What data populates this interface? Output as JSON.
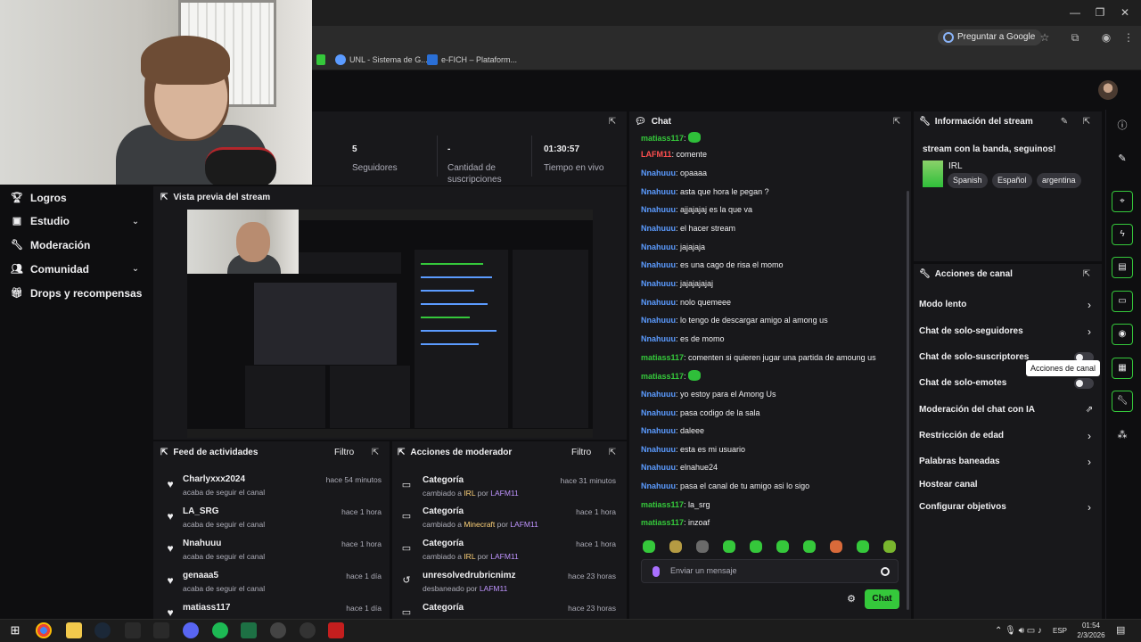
{
  "browser": {
    "ask_google": "Preguntar a Google",
    "bookmarks": [
      {
        "label": "UNL - Sistema de G..."
      },
      {
        "label": "e-FICH – Plataform..."
      }
    ]
  },
  "sidebar": {
    "items": [
      {
        "label": "Logros",
        "icon": "trophy-icon"
      },
      {
        "label": "Estudio",
        "icon": "camera-icon"
      },
      {
        "label": "Moderación",
        "icon": "wrench-icon"
      },
      {
        "label": "Comunidad",
        "icon": "people-icon"
      },
      {
        "label": "Drops y recompensas",
        "icon": "gift-icon"
      }
    ]
  },
  "stats": {
    "followers_value": "5",
    "followers_label": "Seguidores",
    "subs_value": "-",
    "subs_label": "Cantidad de suscripciones",
    "live_value": "01:30:57",
    "live_label": "Tiempo en vivo"
  },
  "preview": {
    "title": "Vista previa del stream"
  },
  "feed": {
    "title": "Feed de actividades",
    "filter": "Filtro",
    "items": [
      {
        "name": "Charlyxxx2024",
        "sub": "acaba de seguir el canal",
        "time": "hace 54 minutos"
      },
      {
        "name": "LA_SRG",
        "sub": "acaba de seguir el canal",
        "time": "hace 1 hora"
      },
      {
        "name": "Nnahuuu",
        "sub": "acaba de seguir el canal",
        "time": "hace 1 hora"
      },
      {
        "name": "genaaa5",
        "sub": "acaba de seguir el canal",
        "time": "hace 1 día"
      },
      {
        "name": "matiass117",
        "sub": "",
        "time": "hace 1 día"
      }
    ]
  },
  "mod": {
    "title": "Acciones de moderador",
    "filter": "Filtro",
    "items": [
      {
        "title": "Categoría",
        "pre": "cambiado a ",
        "target": "IRL",
        "mid": " por ",
        "by": "LAFM11",
        "time": "hace 31 minutos"
      },
      {
        "title": "Categoría",
        "pre": "cambiado a ",
        "target": "Minecraft",
        "mid": " por ",
        "by": "LAFM11",
        "time": "hace 1 hora"
      },
      {
        "title": "Categoría",
        "pre": "cambiado a ",
        "target": "IRL",
        "mid": " por ",
        "by": "LAFM11",
        "time": "hace 1 hora"
      },
      {
        "title": "unresolvedrubricnimz",
        "pre": "desbaneado por ",
        "target": "",
        "mid": "",
        "by": "LAFM11",
        "time": "hace 23 horas"
      },
      {
        "title": "Categoría",
        "pre": "",
        "target": "",
        "mid": "",
        "by": "",
        "time": "hace 23 horas"
      }
    ]
  },
  "chat": {
    "title": "Chat",
    "placeholder": "Enviar un mensaje",
    "send": "Chat",
    "messages": [
      {
        "user": "matiass117",
        "color": "#35c83b",
        "text": ": ",
        "emote": true
      },
      {
        "user": "LAFM11",
        "color": "#ff4f4f",
        "text": ": comente",
        "emote": false
      },
      {
        "user": "Nnahuuu",
        "color": "#5b9bff",
        "text": ": opaaaa",
        "emote": false
      },
      {
        "user": "Nnahuuu",
        "color": "#5b9bff",
        "text": ": asta que hora le pegan ?",
        "emote": false
      },
      {
        "user": "Nnahuuu",
        "color": "#5b9bff",
        "text": ": ajjajajaj es la que va",
        "emote": false
      },
      {
        "user": "Nnahuuu",
        "color": "#5b9bff",
        "text": ": el hacer stream",
        "emote": false
      },
      {
        "user": "Nnahuuu",
        "color": "#5b9bff",
        "text": ": jajajaja",
        "emote": false
      },
      {
        "user": "Nnahuuu",
        "color": "#5b9bff",
        "text": ": es una cago de risa el momo",
        "emote": false
      },
      {
        "user": "Nnahuuu",
        "color": "#5b9bff",
        "text": ": jajajajajaj",
        "emote": false
      },
      {
        "user": "Nnahuuu",
        "color": "#5b9bff",
        "text": ": nolo quemeee",
        "emote": false
      },
      {
        "user": "Nnahuuu",
        "color": "#5b9bff",
        "text": ": lo tengo de descargar amigo al among us",
        "emote": false
      },
      {
        "user": "Nnahuuu",
        "color": "#5b9bff",
        "text": ": es de momo",
        "emote": false
      },
      {
        "user": "matiass117",
        "color": "#35c83b",
        "text": ": comenten si quieren jugar una partida de amoung us",
        "emote": false
      },
      {
        "user": "matiass117",
        "color": "#35c83b",
        "text": ": ",
        "emote": true
      },
      {
        "user": "Nnahuuu",
        "color": "#5b9bff",
        "text": ": yo estoy para el Among Us",
        "emote": false
      },
      {
        "user": "Nnahuuu",
        "color": "#5b9bff",
        "text": ": pasa codigo de la sala",
        "emote": false
      },
      {
        "user": "Nnahuuu",
        "color": "#5b9bff",
        "text": ": daleee",
        "emote": false
      },
      {
        "user": "Nnahuuu",
        "color": "#5b9bff",
        "text": ": esta es mi usuario",
        "emote": false
      },
      {
        "user": "Nnahuuu",
        "color": "#5b9bff",
        "text": ": elnahue24",
        "emote": false
      },
      {
        "user": "Nnahuuu",
        "color": "#5b9bff",
        "text": ": pasa el canal de tu amigo asi lo sigo",
        "emote": false
      },
      {
        "user": "matiass117",
        "color": "#35c83b",
        "text": ": la_srg",
        "emote": false
      },
      {
        "user": "matiass117",
        "color": "#35c83b",
        "text": ": inzoaf",
        "emote": false
      }
    ]
  },
  "stream_info": {
    "title": "Información del stream",
    "stream_title": "stream con la banda, seguinos!",
    "category": "IRL",
    "tags": [
      "Spanish",
      "Español",
      "argentina"
    ]
  },
  "actions": {
    "title": "Acciones de canal",
    "items": [
      {
        "label": "Modo lento",
        "control": "chevron"
      },
      {
        "label": "Chat de solo-seguidores",
        "control": "chevron"
      },
      {
        "label": "Chat de solo-suscriptores",
        "control": "toggle"
      },
      {
        "label": "Chat de solo-emotes",
        "control": "toggle"
      },
      {
        "label": "Moderación del chat con IA",
        "control": "external"
      },
      {
        "label": "Restricción de edad",
        "control": "chevron"
      },
      {
        "label": "Palabras baneadas",
        "control": "chevron"
      },
      {
        "label": "Hostear canal",
        "control": "none"
      },
      {
        "label": "Configurar objetivos",
        "control": "chevron"
      }
    ],
    "tooltip": "Acciones de canal"
  },
  "taskbar": {
    "lang": "ESP",
    "time": "01:54",
    "date": "2/3/2026"
  },
  "colors": {
    "accent": "#35c83b",
    "background": "#0e0e10",
    "panel": "#18181b"
  }
}
